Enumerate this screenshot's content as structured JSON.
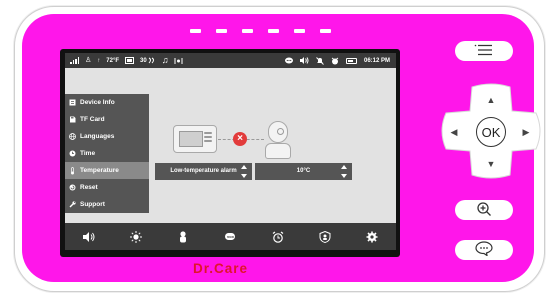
{
  "brand": "Dr.Care",
  "colors": {
    "shell": "#ff16ea",
    "brand_red": "#e0142b",
    "screen_bg": "#e2e2e2",
    "menu_bg": "#555555",
    "menu_active": "#8a8a8a",
    "bar_bg": "#3a3a3a"
  },
  "status_bar": {
    "icons_left": [
      "signal-icon",
      "baby-icon",
      "thermometer-icon",
      "sim-icon",
      "vox-icon",
      "music-note-icon",
      "cry-sensor-icon"
    ],
    "temperature": "72°F",
    "vox_level": "30",
    "icons_right": [
      "chat-icon",
      "speaker-icon",
      "alarm-off-icon",
      "alarm-clock-icon",
      "battery-icon"
    ],
    "time": "06:12 PM"
  },
  "menu": {
    "items": [
      {
        "label": "Device Info",
        "icon": "document-icon",
        "active": false
      },
      {
        "label": "TF Card",
        "icon": "sd-card-icon",
        "active": false
      },
      {
        "label": "Languages",
        "icon": "globe-icon",
        "active": false
      },
      {
        "label": "Time",
        "icon": "clock-icon",
        "active": false
      },
      {
        "label": "Temperature",
        "icon": "thermometer-icon",
        "active": true
      },
      {
        "label": "Reset",
        "icon": "reset-icon",
        "active": false
      },
      {
        "label": "Support",
        "icon": "wrench-icon",
        "active": false
      }
    ]
  },
  "temperature_panel": {
    "alarm_label": "Low-temperature alarm",
    "alarm_value": "10°C",
    "connection_status": "disconnected"
  },
  "bottom_bar": {
    "icons": [
      "volume-icon",
      "brightness-icon",
      "baby-icon",
      "vox-icon",
      "alarm-clock-icon",
      "camera-switch-icon",
      "settings-icon"
    ],
    "vox_text": "vox"
  },
  "buttons": {
    "menu": "menu-icon",
    "zoom": "zoom-in-icon",
    "talk": "talk-icon",
    "ok_label": "OK"
  }
}
